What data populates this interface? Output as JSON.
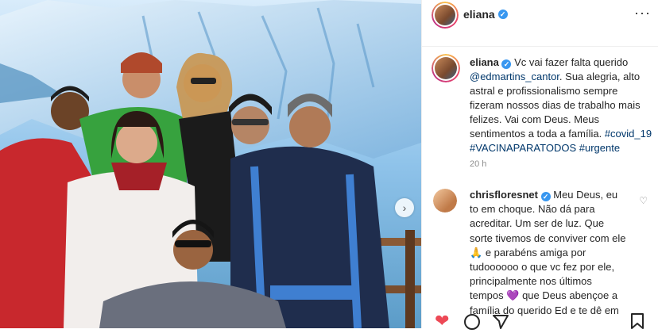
{
  "header": {
    "username": "eliana"
  },
  "caption": {
    "username": "eliana",
    "text_1": "Vc vai fazer falta querido",
    "mention": "@edmartins_cantor",
    "text_2": ". Sua alegria, alto astral e profissionalismo sempre fizeram nossos dias de trabalho mais felizes. Vai com Deus. Meus sentimentos a toda a família.",
    "hashtags": "#covid_19 #VACINAPARATODOS #urgente",
    "time": "20 h"
  },
  "comment": {
    "username": "chrisfloresnet",
    "text_1": "Meu Deus, eu to em choque. Não dá para acreditar. Um ser de luz. Que sorte tivemos de conviver com ele",
    "emoji_1": "🙏",
    "text_2": "e parabéns amiga por tudoooooo o que vc fez por ele, principalmente nos últimos tempos",
    "emoji_2": "💜",
    "text_3": "que Deus abençoe a família do querido Ed e te dê em"
  },
  "colors": {
    "verified": "#3897f0",
    "like": "#ed4956",
    "link": "#00376b",
    "muted": "#8e8e8e"
  },
  "icons": {
    "more": "more-icon",
    "verified": "verified-badge-icon",
    "like": "heart-icon",
    "comment": "comment-icon",
    "share": "share-icon",
    "save": "save-icon",
    "next": "chevron-right-icon"
  }
}
